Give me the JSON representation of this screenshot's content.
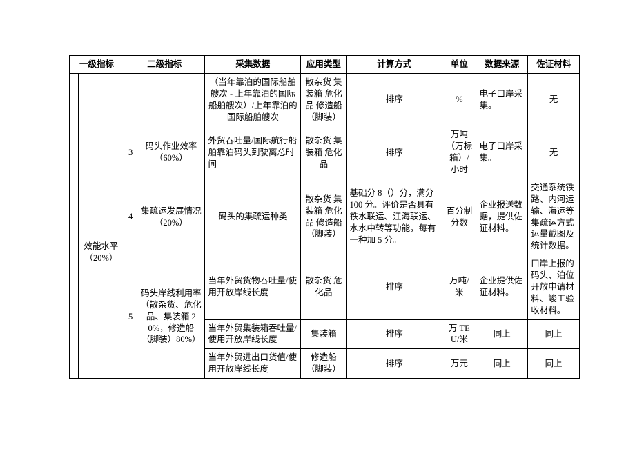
{
  "headers": {
    "c1": "一级指标",
    "c2": "二级指标",
    "c3": "采集数据",
    "c4": "应用类型",
    "c5": "计算方式",
    "c6": "单位",
    "c7": "数据来源",
    "c8": "佐证材料"
  },
  "level1": "效能水平（20%）",
  "rows": [
    {
      "idx": "",
      "l2": "",
      "collect": "（当年靠泊的国际船舶艘次 - 上年靠泊的国际船舶艘次）/上年靠泊的国际船舶艘次",
      "type": "散杂货 集装箱 危化品 修造船（脚装）",
      "calc": "排序",
      "unit": "%",
      "src": "电子口岸采集。",
      "proof": "无"
    },
    {
      "idx": "3",
      "l2": "码头作业效率（60%）",
      "collect": "外贸吞吐量/国际航行船舶靠泊码头到驶离总时间",
      "type": "散杂货 集装箱 危化品",
      "calc": "排序",
      "unit": "万吨（万标箱）/小时",
      "src": "电子口岸采集。",
      "proof": "无"
    },
    {
      "idx": "4",
      "l2": "集疏运发展情况（20%）",
      "collect": "码头的集疏运种类",
      "type": "散杂货 集装箱 危化品 修造船（脚装）",
      "calc": "基础分 8（）分，满分 100 分。评价是否具有铁水联运、江海联运、水水中转等功能，每有一种加 5 分。",
      "unit": "百分制分数",
      "src": "企业报送数据，提供佐证材料。",
      "proof": "交通系统铁路、内河运输、海运等集疏运方式运量截图及统计数据。"
    },
    {
      "idx": "5",
      "l2": "码头岸线利用率（散杂货、危化品、集装箱 20%，修造船（脚装）80%）",
      "collect": "当年外贸货物吞吐量/使用开放岸线长度",
      "type": "散杂货 危化品",
      "calc": "排序",
      "unit": "万吨/米",
      "src": "企业提供佐证材料。",
      "proof": "口岸上报的码头、泊位开放申请材料、竣工验收材料。"
    },
    {
      "collect": "当年外贸集装箱吞吐量/使用开放岸线长度",
      "type": "集装箱",
      "calc": "排序",
      "unit": "万 TEU/米",
      "src": "同上",
      "proof": "同上"
    },
    {
      "collect": "当年外贸进出口货值/使用开放岸线长度",
      "type": "修造船（脚装）",
      "calc": "排序",
      "unit": "万元",
      "src": "同上",
      "proof": "同上"
    }
  ]
}
